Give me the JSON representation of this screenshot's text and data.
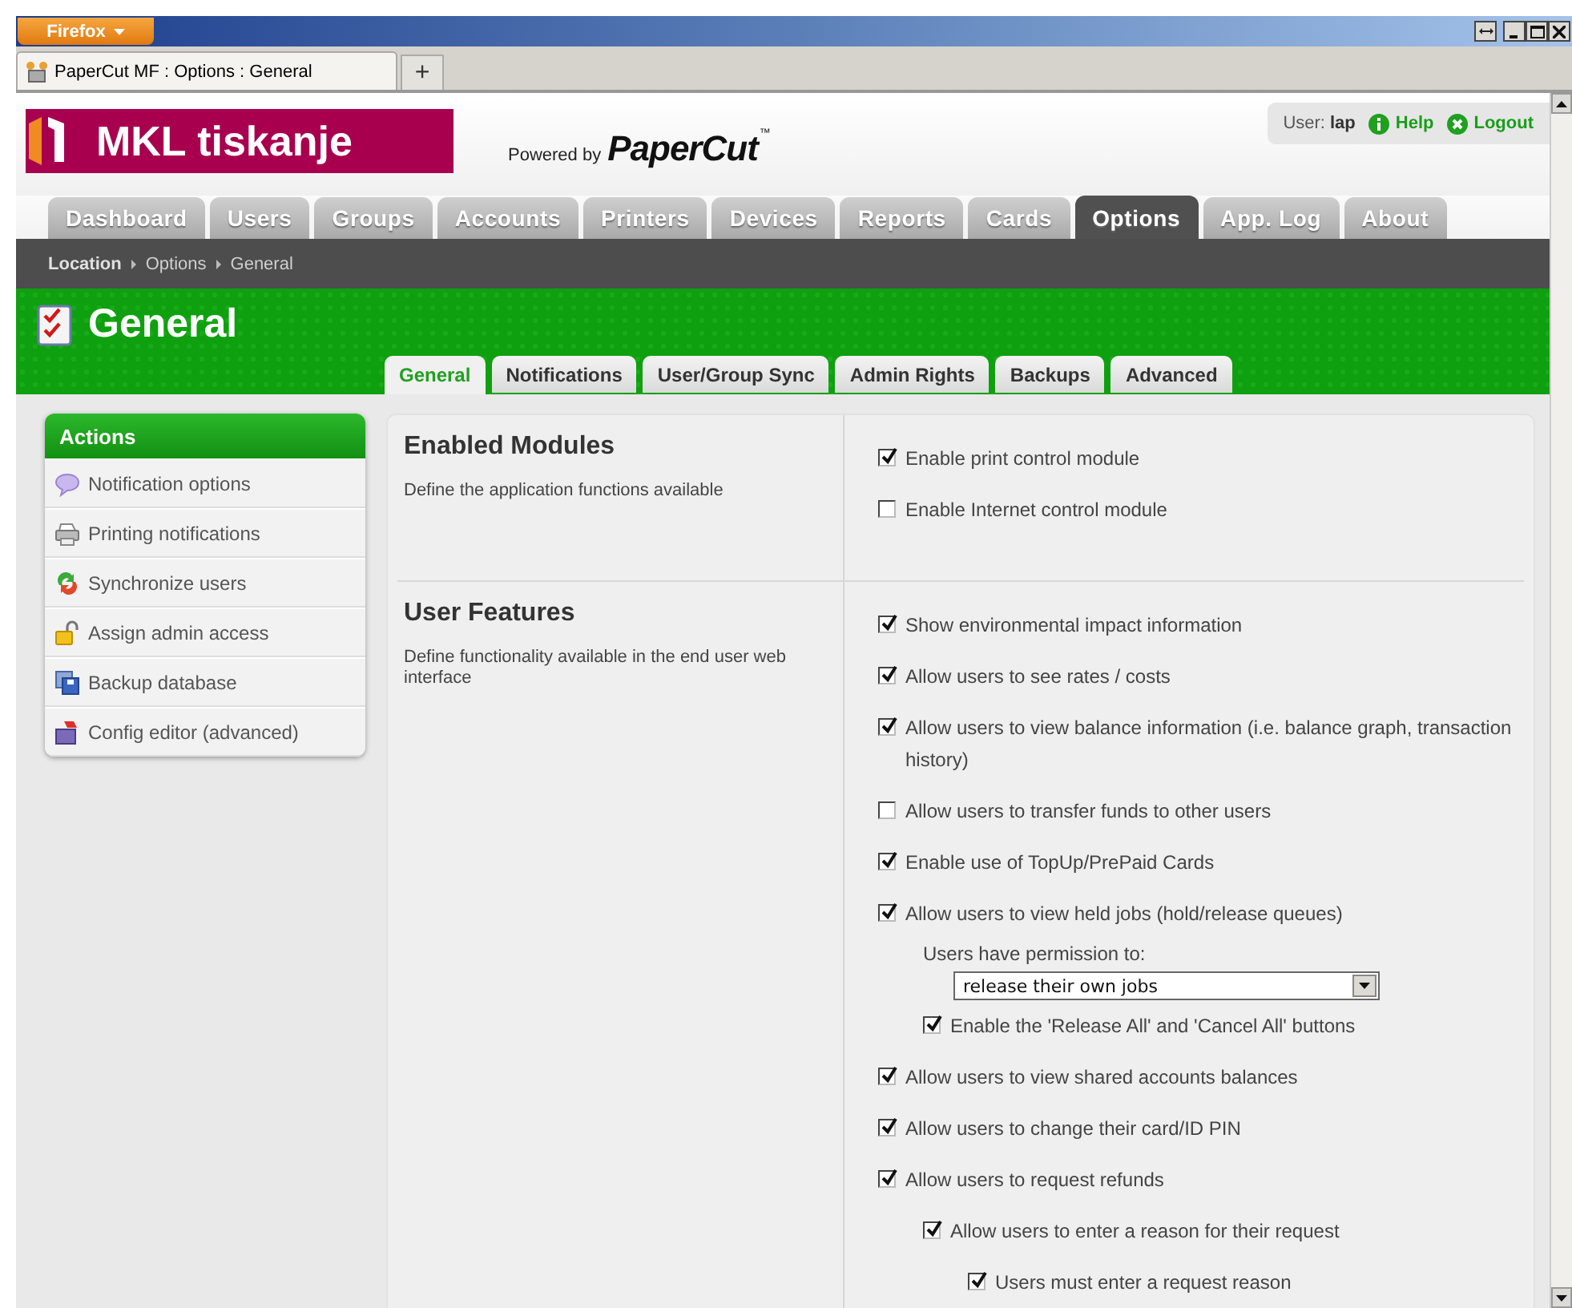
{
  "browser": {
    "menu_button": "Firefox",
    "tab_title": "PaperCut MF : Options : General",
    "new_tab": "+"
  },
  "header": {
    "logo_text": "MKL tiskanje",
    "powered_by": "Powered by",
    "brand": "PaperCut",
    "trademark": "™",
    "user_label": "User:",
    "user_name": "lap",
    "links": [
      {
        "label": "Help",
        "kind": "help"
      },
      {
        "label": "Logout",
        "kind": "logout"
      }
    ]
  },
  "nav_tabs": [
    {
      "label": "Dashboard",
      "selected": false
    },
    {
      "label": "Users",
      "selected": false
    },
    {
      "label": "Groups",
      "selected": false
    },
    {
      "label": "Accounts",
      "selected": false
    },
    {
      "label": "Printers",
      "selected": false
    },
    {
      "label": "Devices",
      "selected": false
    },
    {
      "label": "Reports",
      "selected": false
    },
    {
      "label": "Cards",
      "selected": false
    },
    {
      "label": "Options",
      "selected": true
    },
    {
      "label": "App. Log",
      "selected": false
    },
    {
      "label": "About",
      "selected": false
    }
  ],
  "breadcrumb": [
    "Location",
    "Options",
    "General"
  ],
  "page_title": "General",
  "sub_tabs": [
    {
      "label": "General",
      "selected": true
    },
    {
      "label": "Notifications",
      "selected": false
    },
    {
      "label": "User/Group Sync",
      "selected": false
    },
    {
      "label": "Admin Rights",
      "selected": false
    },
    {
      "label": "Backups",
      "selected": false
    },
    {
      "label": "Advanced",
      "selected": false
    }
  ],
  "actions": {
    "title": "Actions",
    "items": [
      {
        "label": "Notification options",
        "kind": "speech"
      },
      {
        "label": "Printing notifications",
        "kind": "printer"
      },
      {
        "label": "Synchronize users",
        "kind": "sync"
      },
      {
        "label": "Assign admin access",
        "kind": "lock"
      },
      {
        "label": "Backup database",
        "kind": "disk"
      },
      {
        "label": "Config editor (advanced)",
        "kind": "box"
      }
    ]
  },
  "sections": [
    {
      "title": "Enabled Modules",
      "description": "Define the application functions available",
      "options": [
        {
          "kind": "checkbox",
          "label": "Enable print control module",
          "checked": true
        },
        {
          "kind": "checkbox",
          "label": "Enable Internet control module",
          "checked": false
        }
      ]
    },
    {
      "title": "User Features",
      "description": "Define functionality available in the end user web interface",
      "options": [
        {
          "kind": "checkbox",
          "label": "Show environmental impact information",
          "checked": true
        },
        {
          "kind": "checkbox",
          "label": "Allow users to see rates / costs",
          "checked": true
        },
        {
          "kind": "checkbox",
          "label": "Allow users to view balance information (i.e. balance graph, transaction history)",
          "checked": true
        },
        {
          "kind": "checkbox",
          "label": "Allow users to transfer funds to other users",
          "checked": false
        },
        {
          "kind": "checkbox",
          "label": "Enable use of TopUp/PrePaid Cards",
          "checked": true
        },
        {
          "kind": "checkbox",
          "label": "Allow users to view held jobs (hold/release queues)",
          "checked": true,
          "children": [
            {
              "kind": "select",
              "label": "Users have permission to:",
              "value": "release their own jobs"
            },
            {
              "kind": "checkbox",
              "label": "Enable the 'Release All' and 'Cancel All' buttons",
              "checked": true
            }
          ]
        },
        {
          "kind": "checkbox",
          "label": "Allow users to view shared accounts balances",
          "checked": true
        },
        {
          "kind": "checkbox",
          "label": "Allow users to change their card/ID PIN",
          "checked": true
        },
        {
          "kind": "checkbox",
          "label": "Allow users to request refunds",
          "checked": true,
          "children": [
            {
              "kind": "checkbox",
              "label": "Allow users to enter a reason for their request",
              "checked": true,
              "children": [
                {
                  "kind": "checkbox",
                  "label": "Users must enter a request reason",
                  "checked": true
                }
              ]
            }
          ]
        }
      ]
    }
  ]
}
